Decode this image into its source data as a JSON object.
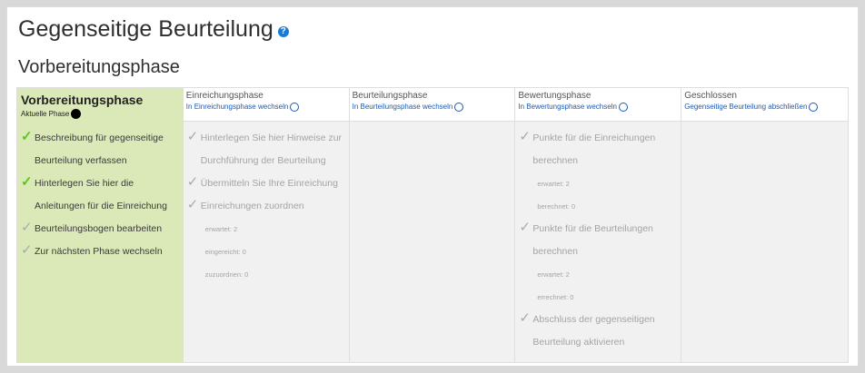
{
  "page_title": "Gegenseitige Beurteilung",
  "phase_title": "Vorbereitungsphase",
  "phases": [
    {
      "name": "Vorbereitungsphase",
      "current_label": "Aktuelle Phase",
      "tasks": [
        {
          "label": "Beschreibung für gegenseitige Beurteilung verfassen",
          "status": "done"
        },
        {
          "label": "Hinterlegen Sie hier die Anleitungen für die Einreichung",
          "status": "done"
        },
        {
          "label": "Beurteilungsbogen bearbeiten",
          "status": "todo"
        },
        {
          "label": "Zur nächsten Phase wechseln",
          "status": "todo"
        }
      ]
    },
    {
      "name": "Einreichungsphase",
      "link": "In Einreichungsphase wechseln",
      "tasks": [
        {
          "label": "Hinterlegen Sie hier Hinweise zur Durchführung der Beurteilung"
        },
        {
          "label": "Übermitteln Sie Ihre Einreichung"
        },
        {
          "label": "Einreichungen zuordnen",
          "info": [
            "erwartet: 2",
            "eingereicht: 0",
            "zuzuordnen: 0"
          ]
        }
      ]
    },
    {
      "name": "Beurteilungsphase",
      "link": "In Beurteilungsphase wechseln"
    },
    {
      "name": "Bewertungsphase",
      "link": "In Bewertungsphase wechseln",
      "tasks": [
        {
          "label": "Punkte für die Einreichungen berechnen",
          "info": [
            "erwartet: 2",
            "berechnet: 0"
          ]
        },
        {
          "label": "Punkte für die Beurteilungen berechnen",
          "info": [
            "erwartet: 2",
            "errechnet: 0"
          ]
        },
        {
          "label": "Abschluss der gegenseitigen Beurteilung aktivieren"
        }
      ]
    },
    {
      "name": "Geschlossen",
      "link": "Gegenseitige Beurteilung abschließen"
    }
  ],
  "colors": {
    "active_phase_bg": "#dbe9b8",
    "link": "#1a5bb3",
    "done_check": "#5ec51e",
    "help_icon": "#1a7bd4"
  },
  "icons": {
    "help": "help-circle-icon",
    "done": "checkmark-icon",
    "todo": "checkmark-outline-icon",
    "switch": "circle-outline-icon",
    "current": "filled-circle-icon"
  }
}
